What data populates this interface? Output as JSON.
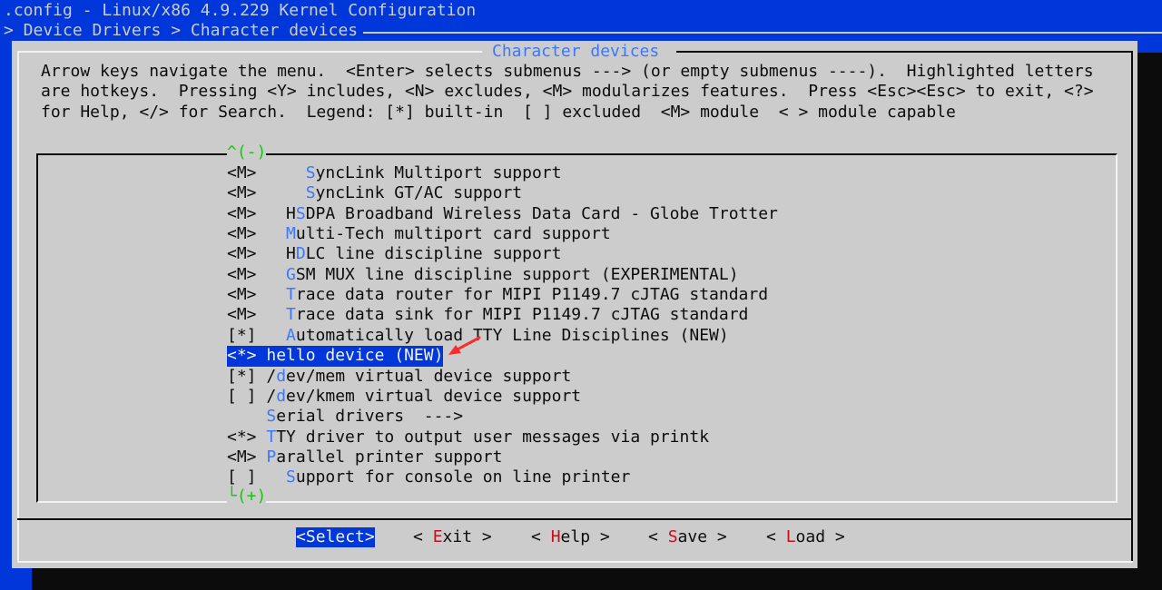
{
  "window_title": ".config - Linux/x86 4.9.229 Kernel Configuration",
  "breadcrumb": "> Device Drivers > Character devices",
  "dialog": {
    "title": "Character devices",
    "help_lines": [
      "Arrow keys navigate the menu.  <Enter> selects submenus ---> (or empty submenus ----).  Highlighted letters",
      "are hotkeys.  Pressing <Y> includes, <N> excludes, <M> modularizes features.  Press <Esc><Esc> to exit, <?>",
      "for Help, </> for Search.  Legend: [*] built-in  [ ] excluded  <M> module  < > module capable"
    ]
  },
  "scroll_up": "^(-)",
  "scroll_down": "└(+)",
  "menu_items": [
    {
      "pre": "<M>     ",
      "hotkey": "S",
      "rest": "yncLink Multiport support"
    },
    {
      "pre": "<M>     ",
      "hotkey": "S",
      "rest": "yncLink GT/AC support"
    },
    {
      "pre": "<M>   H",
      "hotkey": "S",
      "rest": "DPA Broadband Wireless Data Card - Globe Trotter"
    },
    {
      "pre": "<M>   ",
      "hotkey": "M",
      "rest": "ulti-Tech multiport card support"
    },
    {
      "pre": "<M>   H",
      "hotkey": "D",
      "rest": "LC line discipline support"
    },
    {
      "pre": "<M>   ",
      "hotkey": "G",
      "rest": "SM MUX line discipline support (EXPERIMENTAL)"
    },
    {
      "pre": "<M>   ",
      "hotkey": "T",
      "rest": "race data router for MIPI P1149.7 cJTAG standard"
    },
    {
      "pre": "<M>   ",
      "hotkey": "T",
      "rest": "race data sink for MIPI P1149.7 cJTAG standard"
    },
    {
      "pre": "[*]   ",
      "hotkey": "A",
      "rest": "utomatically load TTY Line Disciplines (NEW)"
    },
    {
      "pre": "<*> ",
      "hotkey": "h",
      "rest": "ello device (NEW)"
    },
    {
      "pre": "[*] /",
      "hotkey": "d",
      "rest": "ev/mem virtual device support"
    },
    {
      "pre": "[ ] /",
      "hotkey": "d",
      "rest": "ev/kmem virtual device support"
    },
    {
      "pre": "    ",
      "hotkey": "S",
      "rest": "erial drivers  --->"
    },
    {
      "pre": "<*> ",
      "hotkey": "T",
      "rest": "TY driver to output user messages via printk"
    },
    {
      "pre": "<M> ",
      "hotkey": "P",
      "rest": "arallel printer support"
    },
    {
      "pre": "[ ]   ",
      "hotkey": "S",
      "rest": "upport for console on line printer"
    }
  ],
  "selected_index": 9,
  "buttons": [
    {
      "pre": "<",
      "hotkey": "S",
      "rest": "elect>"
    },
    {
      "pre": "< ",
      "hotkey": "E",
      "rest": "xit >"
    },
    {
      "pre": "< ",
      "hotkey": "H",
      "rest": "elp >"
    },
    {
      "pre": "< ",
      "hotkey": "S",
      "rest": "ave >"
    },
    {
      "pre": "< ",
      "hotkey": "L",
      "rest": "oad >"
    }
  ],
  "annotation_arrow_color": "#ff2a2a"
}
